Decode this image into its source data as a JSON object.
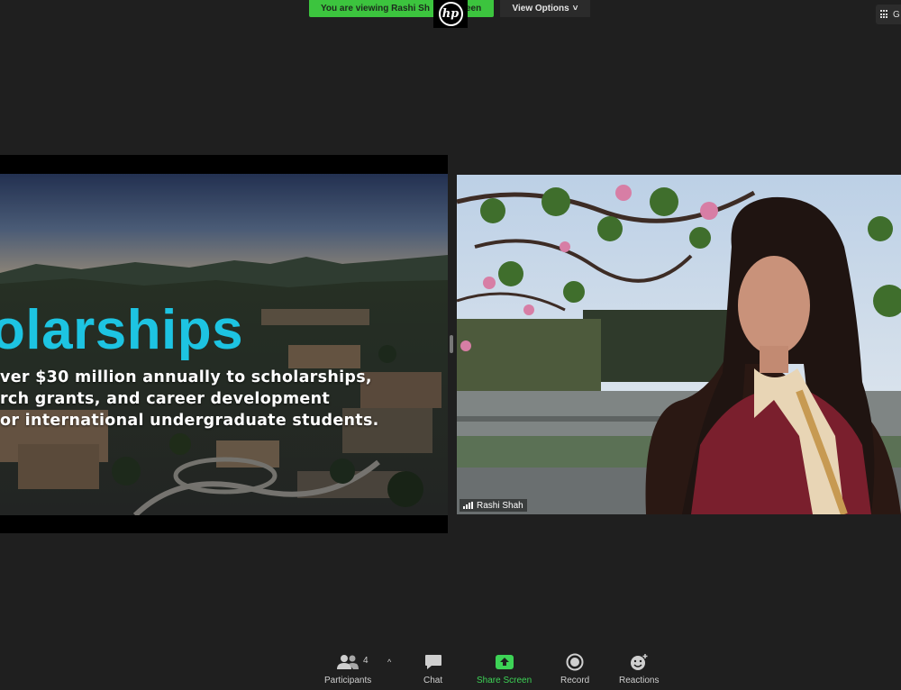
{
  "banner": {
    "viewing_text": "You are viewing Rashi Sh",
    "viewing_suffix": "een"
  },
  "logo": {
    "text": "hp"
  },
  "view_options": {
    "label": "View Options",
    "chevron": "˅"
  },
  "gallery": {
    "label": "G"
  },
  "slide": {
    "title": "olarships",
    "lines": [
      "ver $30 million annually to scholarships,",
      "rch grants, and career development",
      "or international undergraduate students."
    ]
  },
  "video": {
    "participant_name": "Rashi Shah"
  },
  "toolbar": {
    "participants_count": "4",
    "participants_label": "Participants",
    "caret": "^",
    "chat_label": "Chat",
    "share_label": "Share Screen",
    "record_label": "Record",
    "reactions_label": "Reactions"
  },
  "colors": {
    "share_green": "#3dd356",
    "banner_green": "#3cc43e",
    "slide_title": "#1dc4e2",
    "background": "#1f1f1f"
  },
  "icons": [
    "hp-logo",
    "grid-icon",
    "participants-icon",
    "chat-icon",
    "share-screen-icon",
    "record-icon",
    "reactions-icon",
    "signal-icon"
  ]
}
